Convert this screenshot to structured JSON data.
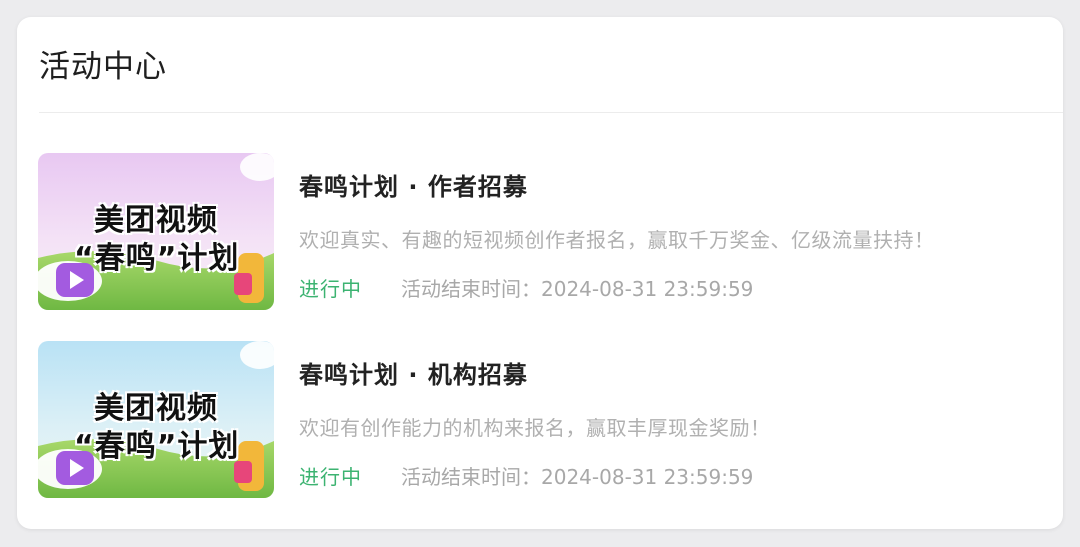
{
  "header": {
    "title": "活动中心"
  },
  "activities": [
    {
      "title": "春鸣计划 · 作者招募",
      "description": "欢迎真实、有趣的短视频创作者报名，赢取千万奖金、亿级流量扶持！",
      "status": "进行中",
      "end_time": "活动结束时间：2024-08-31 23:59:59",
      "banner_line1": "美团视频",
      "banner_line2": "“春鸣”计划"
    },
    {
      "title": "春鸣计划 · 机构招募",
      "description": "欢迎有创作能力的机构来报名，赢取丰厚现金奖励！",
      "status": "进行中",
      "end_time": "活动结束时间：2024-08-31 23:59:59",
      "banner_line1": "美团视频",
      "banner_line2": "“春鸣”计划"
    }
  ],
  "colors": {
    "status_active": "#3cb371",
    "title_text": "#222222",
    "muted_text": "#b0b0b0"
  }
}
